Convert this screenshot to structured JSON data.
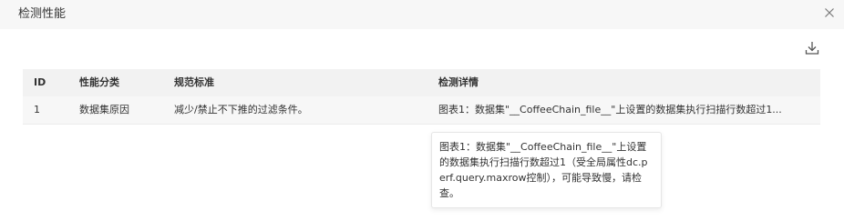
{
  "dialog": {
    "title": "检测性能",
    "close_icon": "close-icon",
    "download_icon": "download-icon"
  },
  "table": {
    "headers": [
      "ID",
      "性能分类",
      "规范标准",
      "检测详情"
    ],
    "rows": [
      {
        "id": "1",
        "category": "数据集原因",
        "standard": "减少/禁止不下推的过滤条件。",
        "detail": "图表1：数据集\"__CoffeeChain_file__\"上设置的数据集执行扫描行数超过1..."
      }
    ]
  },
  "tooltip": {
    "text": "图表1：数据集\"__CoffeeChain_file__\"上设置的数据集执行扫描行数超过1（受全局属性dc.perf.query.maxrow控制），可能导致慢，请检查。"
  }
}
